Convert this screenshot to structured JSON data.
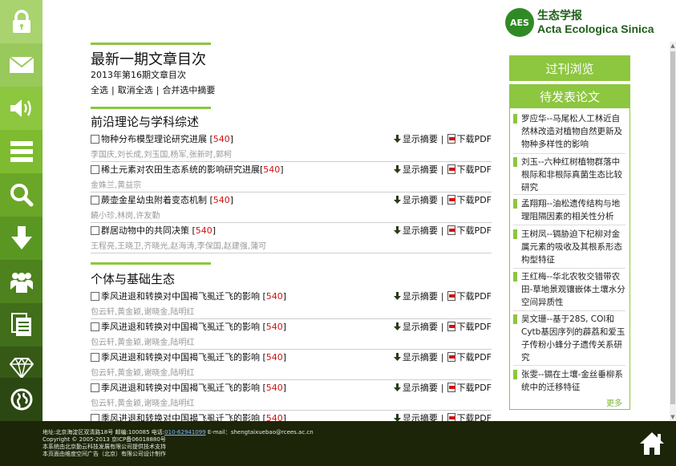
{
  "logo": {
    "badge": "AES",
    "name_cn": "生态学报",
    "name_en": "Acta Ecologica Sinica"
  },
  "sidebar": {
    "items": [
      {
        "icon": "lock-icon",
        "color": "#a9d36e"
      },
      {
        "icon": "mail-icon",
        "color": "#98c95a"
      },
      {
        "icon": "speaker-icon",
        "color": "#8dc63f"
      },
      {
        "icon": "menu-icon",
        "color": "#7fbb30"
      },
      {
        "icon": "search-icon",
        "color": "#6aa728"
      },
      {
        "icon": "download-icon",
        "color": "#5a9722"
      },
      {
        "icon": "people-icon",
        "color": "#4e821e"
      },
      {
        "icon": "document-icon",
        "color": "#416e1a"
      },
      {
        "icon": "diamond-icon",
        "color": "#365a16"
      },
      {
        "icon": "globe-icon",
        "color": "#2b4712"
      }
    ]
  },
  "main": {
    "title": "最新一期文章目次",
    "issue": "2013年第16期文章目次",
    "select_all": "全选",
    "deselect_all": "取消全选",
    "merge_abstracts": "合并选中摘要",
    "show_abstract": "显示摘要",
    "download_pdf": "下载PDF",
    "sections": [
      {
        "title": "前沿理论与学科综述",
        "articles": [
          {
            "title": "物种分布模型理论研究进展",
            "num": "540",
            "authors": "李国庆,刘长成,刘玉国,杨军,张新时,郭柯"
          },
          {
            "title": "稀土元素对农田生态系统的影响研究进展",
            "num": "540",
            "authors": "金姝兰,黄益宗"
          },
          {
            "title": "蕨壶金星幼虫附着变态机制",
            "num": "540",
            "authors": "饒小珍,林岗,许友勤"
          },
          {
            "title": "群居动物中的共同决策",
            "num": "540",
            "authors": "王程亮,王晓卫,齐晓光,赵海涛,李保国,赵建强,蒲可"
          }
        ]
      },
      {
        "title": "个体与基础生态",
        "articles": [
          {
            "title": "季风进退和转换对中国褐飞虱迁飞的影响",
            "num": "540",
            "authors": "包云轩,黄金颖,谢晓金,陆明红"
          },
          {
            "title": "季风进退和转换对中国褐飞虱迁飞的影响",
            "num": "540",
            "authors": "包云轩,黄金颖,谢晓金,陆明红"
          },
          {
            "title": "季风进退和转换对中国褐飞虱迁飞的影响",
            "num": "540",
            "authors": "包云轩,黄金颖,谢晓金,陆明红"
          },
          {
            "title": "季风进退和转换对中国褐飞虱迁飞的影响",
            "num": "540",
            "authors": "包云轩,黄金颖,谢晓金,陆明红"
          },
          {
            "title": "季风进退和转换对中国褐飞虱迁飞的影响",
            "num": "540",
            "authors": ""
          }
        ]
      }
    ]
  },
  "right_panel": {
    "past_issues": "过刊浏览",
    "pending_title": "待发表论文",
    "pending": [
      "罗应华--马尾松人工林近自然林改造对植物自然更新及物种多样性的影响",
      "刘玉--六种红树植物群落中根际和非根际真菌生态比较研究",
      "孟翔翔--油松遗传结构与地理阻隔因素的相关性分析",
      "王树凤--镉胁迫下杞柳对金属元素的吸收及其根系形态构型特征",
      "王红梅--华北农牧交错带农田-草地景观镶嵌体土壤水分空间异质性",
      "吴文珊--基于28S, COI和Cytb基因序列的薜荔和爱玉子传粉小蜂分子遗传关系研究",
      "张雯--镉在土壤-金丝垂柳系统中的迁移特征"
    ],
    "more": "更多"
  },
  "footer": {
    "line1_pre": "地址:北京海淀区双清路18号 邮编:100085 电话:",
    "tel": "010-62941099",
    "line1_post": " E-mail：shengtaixuebao@rcees.ac.cn",
    "line2": "Copyright © 2005-2013 京ICP备06018880号",
    "line3": "本系统由北京勤云科技发展有限公司提供技术支持",
    "line4": "本页面由维度空间广告（北京）有限公司设计制作"
  },
  "colors": {
    "accent": "#8dc63f",
    "sidebar_bg": "#2b3a10",
    "footer_bg": "#1c2507",
    "link_red": "#d01010"
  }
}
